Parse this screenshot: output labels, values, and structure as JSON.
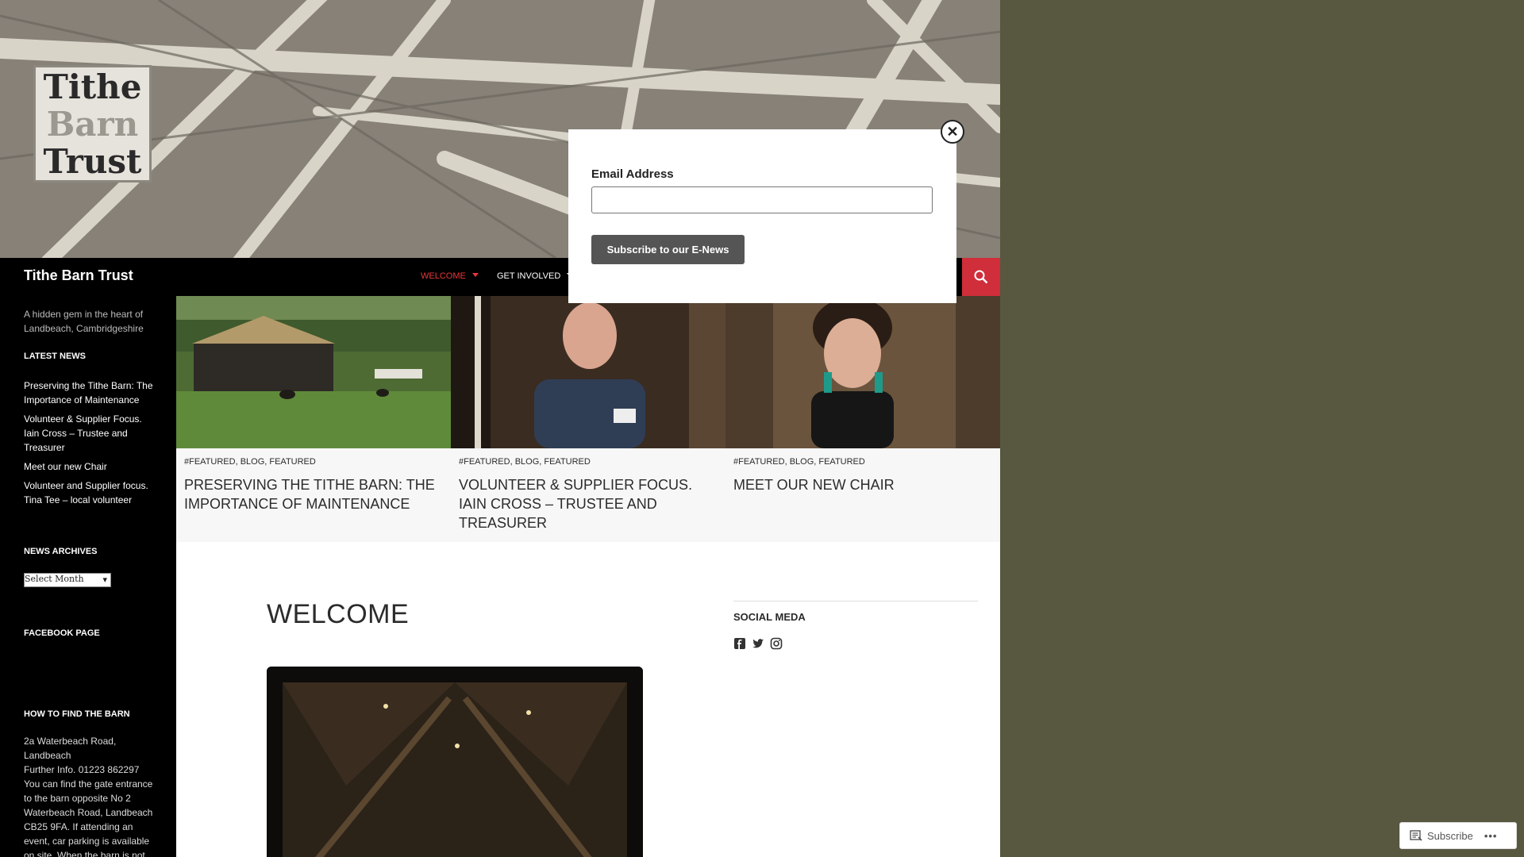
{
  "logo": {
    "line1": "Tithe",
    "line2": "Barn",
    "line3": "Trust"
  },
  "site_title": "Tithe Barn Trust",
  "nav": {
    "items": [
      {
        "label": "Welcome",
        "active": true,
        "has_dropdown": true
      },
      {
        "label": "Get Involved",
        "active": false,
        "has_dropdown": true
      }
    ],
    "search_icon": "search-icon"
  },
  "sidebar": {
    "description": "A hidden gem in the heart of Landbeach, Cambridgeshire",
    "latest_news_heading": "Latest News",
    "latest_news": [
      "Preserving the Tithe Barn: The Importance of Maintenance",
      "Volunteer & Supplier Focus. Iain Cross – Trustee and Treasurer",
      "Meet our new Chair",
      "Volunteer and Supplier focus. Tina Tee – local volunteer"
    ],
    "archives_heading": "News Archives",
    "archives_select": "Select Month",
    "facebook_heading": "Facebook Page",
    "find_heading": "How To Find The Barn",
    "address": "2a Waterbeach Road, Landbeach",
    "further_info": "Further Info. 01223 862297",
    "directions": "You can find the gate entrance to the barn opposite No 2 Waterbeach Road, Landbeach CB25 9FA. If attending an event, car parking is available on site. When the barn is not"
  },
  "featured": [
    {
      "meta": "#Featured, Blog, Featured",
      "title": "Preserving the Tithe Barn: The Importance of Maintenance"
    },
    {
      "meta": "#Featured, Blog, Featured",
      "title": "Volunteer & Supplier Focus. Iain Cross – Trustee and Treasurer"
    },
    {
      "meta": "#Featured, Blog, Featured",
      "title": "Meet our new Chair"
    }
  ],
  "main": {
    "page_title": "WELCOME",
    "social_heading": "Social Meda",
    "social_icons": [
      "facebook-icon",
      "twitter-icon",
      "instagram-icon"
    ]
  },
  "popup": {
    "email_label": "Email Address",
    "email_value": "",
    "submit_label": "Subscribe to our E-News",
    "close_label": "✕"
  },
  "follow_bar": {
    "subscribe_label": "Subscribe",
    "more_label": "•••"
  },
  "colors": {
    "accent": "#cf2e3a",
    "nav_bg": "#000000",
    "page_bg": "#58573f"
  }
}
